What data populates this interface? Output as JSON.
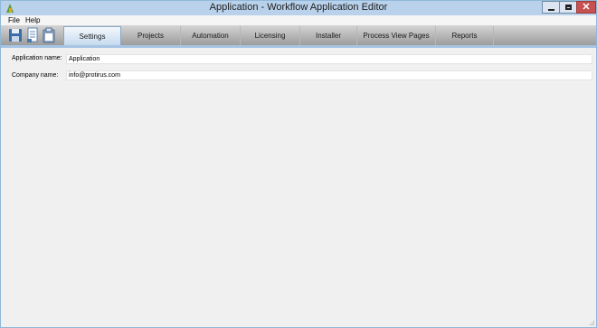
{
  "window": {
    "title": "Application - Workflow Application Editor",
    "controls": {
      "minimize": "minimize",
      "maximize": "maximize",
      "close": "✕"
    }
  },
  "menu": [
    {
      "label": "File"
    },
    {
      "label": "Help"
    }
  ],
  "toolbar": {
    "icons": [
      "save-icon",
      "document-icon",
      "clipboard-icon"
    ]
  },
  "tabs": [
    {
      "label": "Settings",
      "active": true
    },
    {
      "label": "Projects"
    },
    {
      "label": "Automation"
    },
    {
      "label": "Licensing"
    },
    {
      "label": "Installer"
    },
    {
      "label": "Process View Pages"
    },
    {
      "label": "Reports"
    }
  ],
  "form": {
    "application_name": {
      "label": "Application name:",
      "value": "Application"
    },
    "company_name": {
      "label": "Company name:",
      "value": "info@protirus.com"
    }
  },
  "colors": {
    "titlebar": "#b9d1ea",
    "close_button": "#c75050",
    "active_tab": "#c5daef",
    "accent_strip": "#a6c4e3"
  }
}
